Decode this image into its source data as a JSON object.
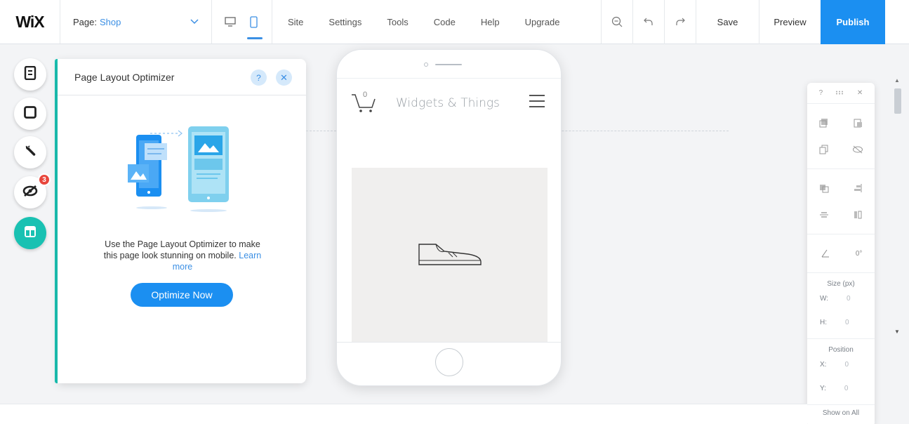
{
  "topbar": {
    "logo": "WiX",
    "page_label": "Page:",
    "page_value": "Shop",
    "menu": [
      "Site",
      "Settings",
      "Tools",
      "Code",
      "Help",
      "Upgrade"
    ],
    "save": "Save",
    "preview": "Preview",
    "publish": "Publish"
  },
  "left_rail": {
    "items": [
      {
        "icon": "pages-icon"
      },
      {
        "icon": "square-icon"
      },
      {
        "icon": "wrench-icon"
      },
      {
        "icon": "hidden-eye-icon",
        "badge": "3"
      },
      {
        "icon": "layout-icon",
        "active": true
      }
    ]
  },
  "optimizer": {
    "title": "Page Layout Optimizer",
    "help": "?",
    "close": "✕",
    "description": "Use the Page Layout Optimizer to make this page look stunning on mobile.",
    "link": "Learn more",
    "cta": "Optimize Now"
  },
  "phone": {
    "cart_count": "0",
    "site_title": "Widgets & Things"
  },
  "inspector": {
    "help": "?",
    "close": "✕",
    "rotation": "0°",
    "size_label": "Size (px)",
    "w_label": "W:",
    "w_value": "0",
    "h_label": "H:",
    "h_value": "0",
    "position_label": "Position",
    "x_label": "X:",
    "x_value": "0",
    "y_label": "Y:",
    "y_value": "0",
    "show_on_all": "Show on All"
  },
  "colors": {
    "accent": "#1b8ff1",
    "rail_active": "#19c1b2",
    "badge": "#e8463c"
  }
}
